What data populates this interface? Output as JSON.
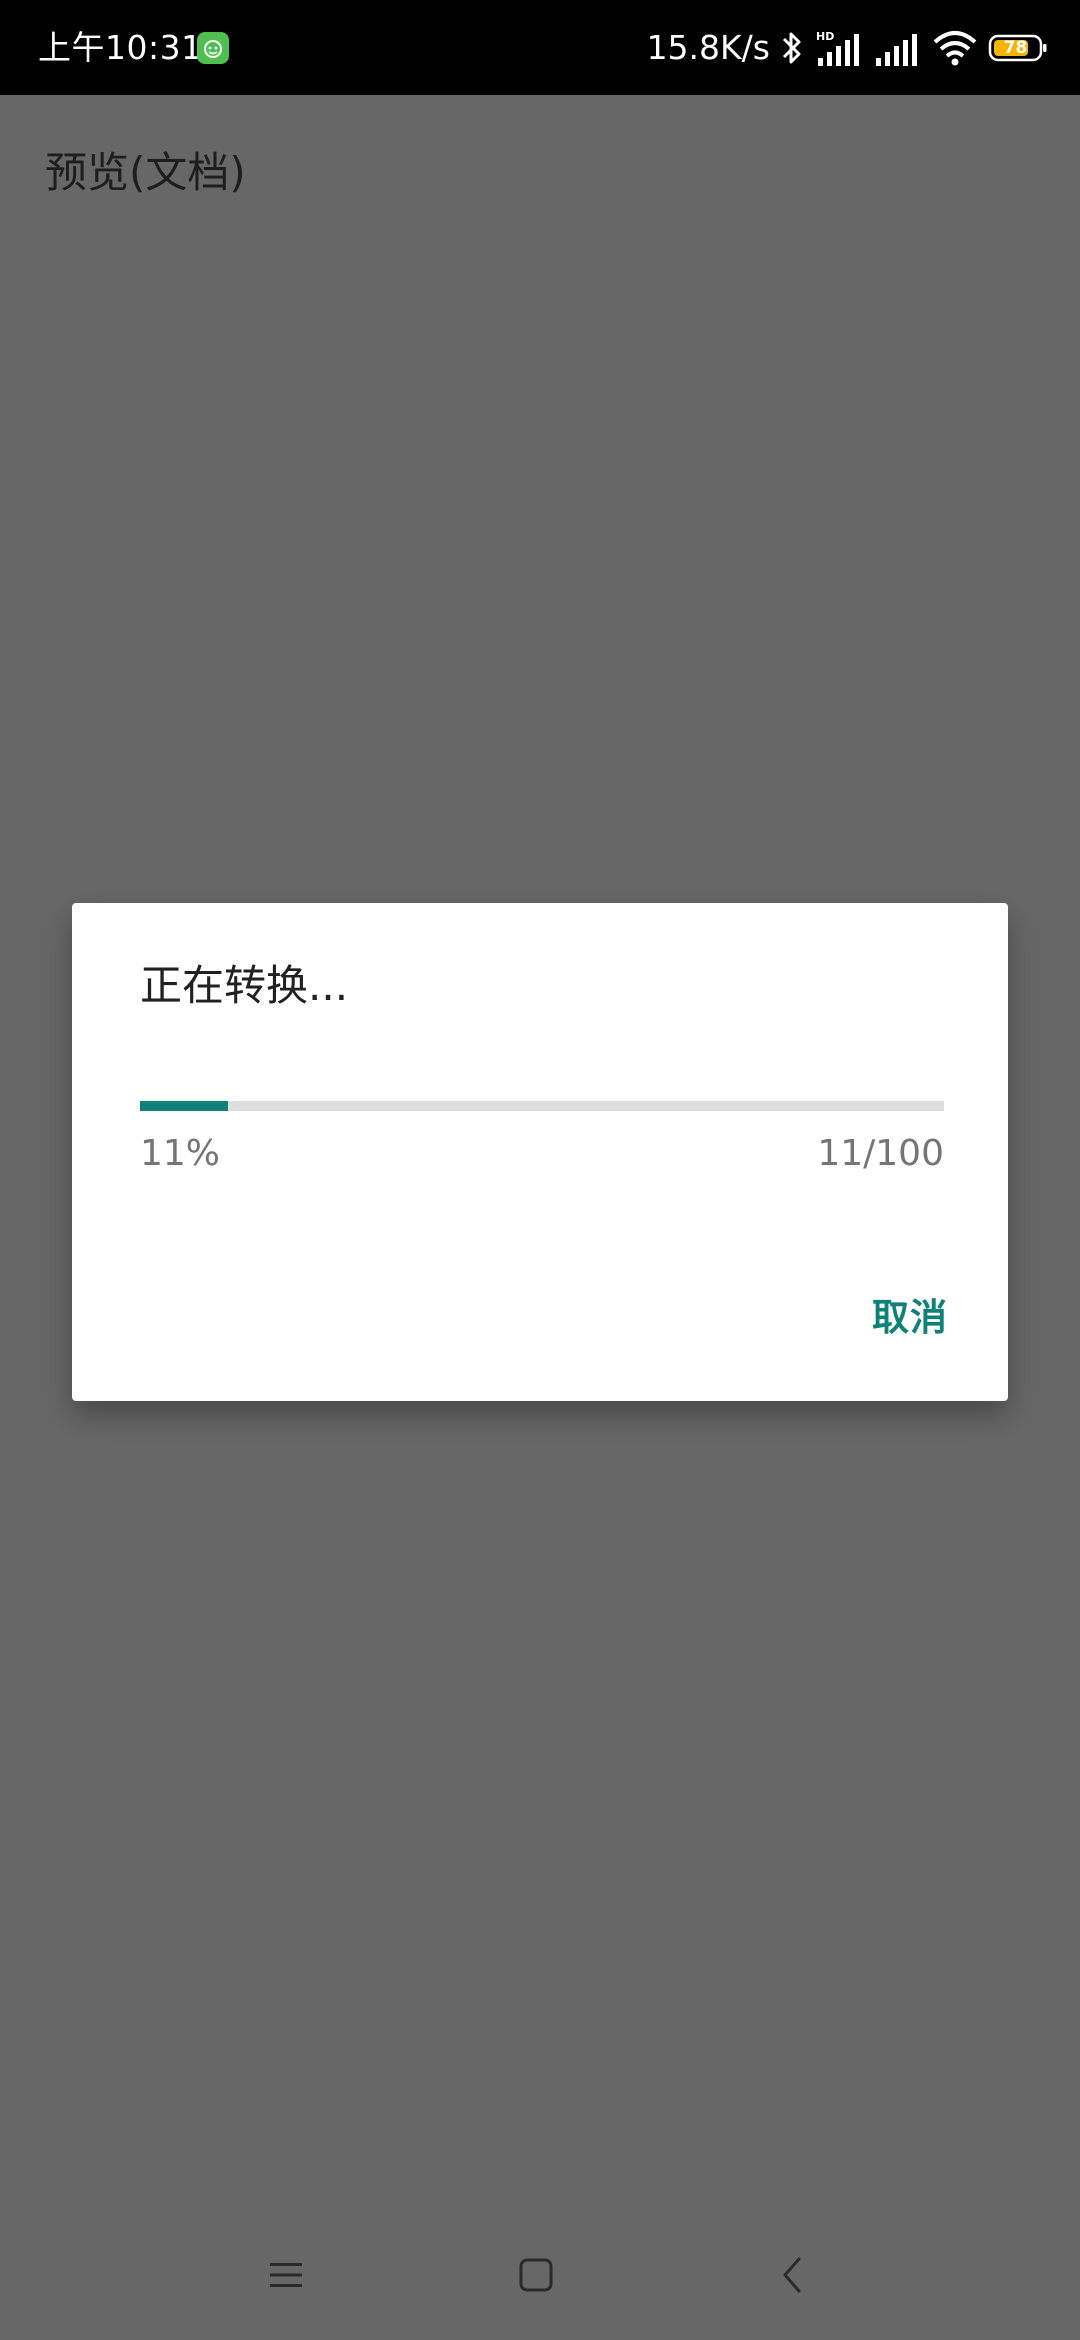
{
  "status_bar": {
    "time": "上午10:31",
    "net_speed": "15.8K/s",
    "battery_level": "78",
    "icons": [
      "app-notification-icon",
      "bluetooth-icon",
      "hd-signal-icon",
      "signal-icon",
      "wifi-icon",
      "battery-icon"
    ]
  },
  "app_bar": {
    "title": "预览(文档)"
  },
  "dialog": {
    "title": "正在转换...",
    "progress_fraction": 0.11,
    "percent_label": "11%",
    "count_label": "11/100",
    "cancel_label": "取消",
    "accent_color": "#0f8277"
  },
  "nav_bar": {
    "icons": [
      "menu-icon",
      "home-icon",
      "back-icon"
    ]
  }
}
